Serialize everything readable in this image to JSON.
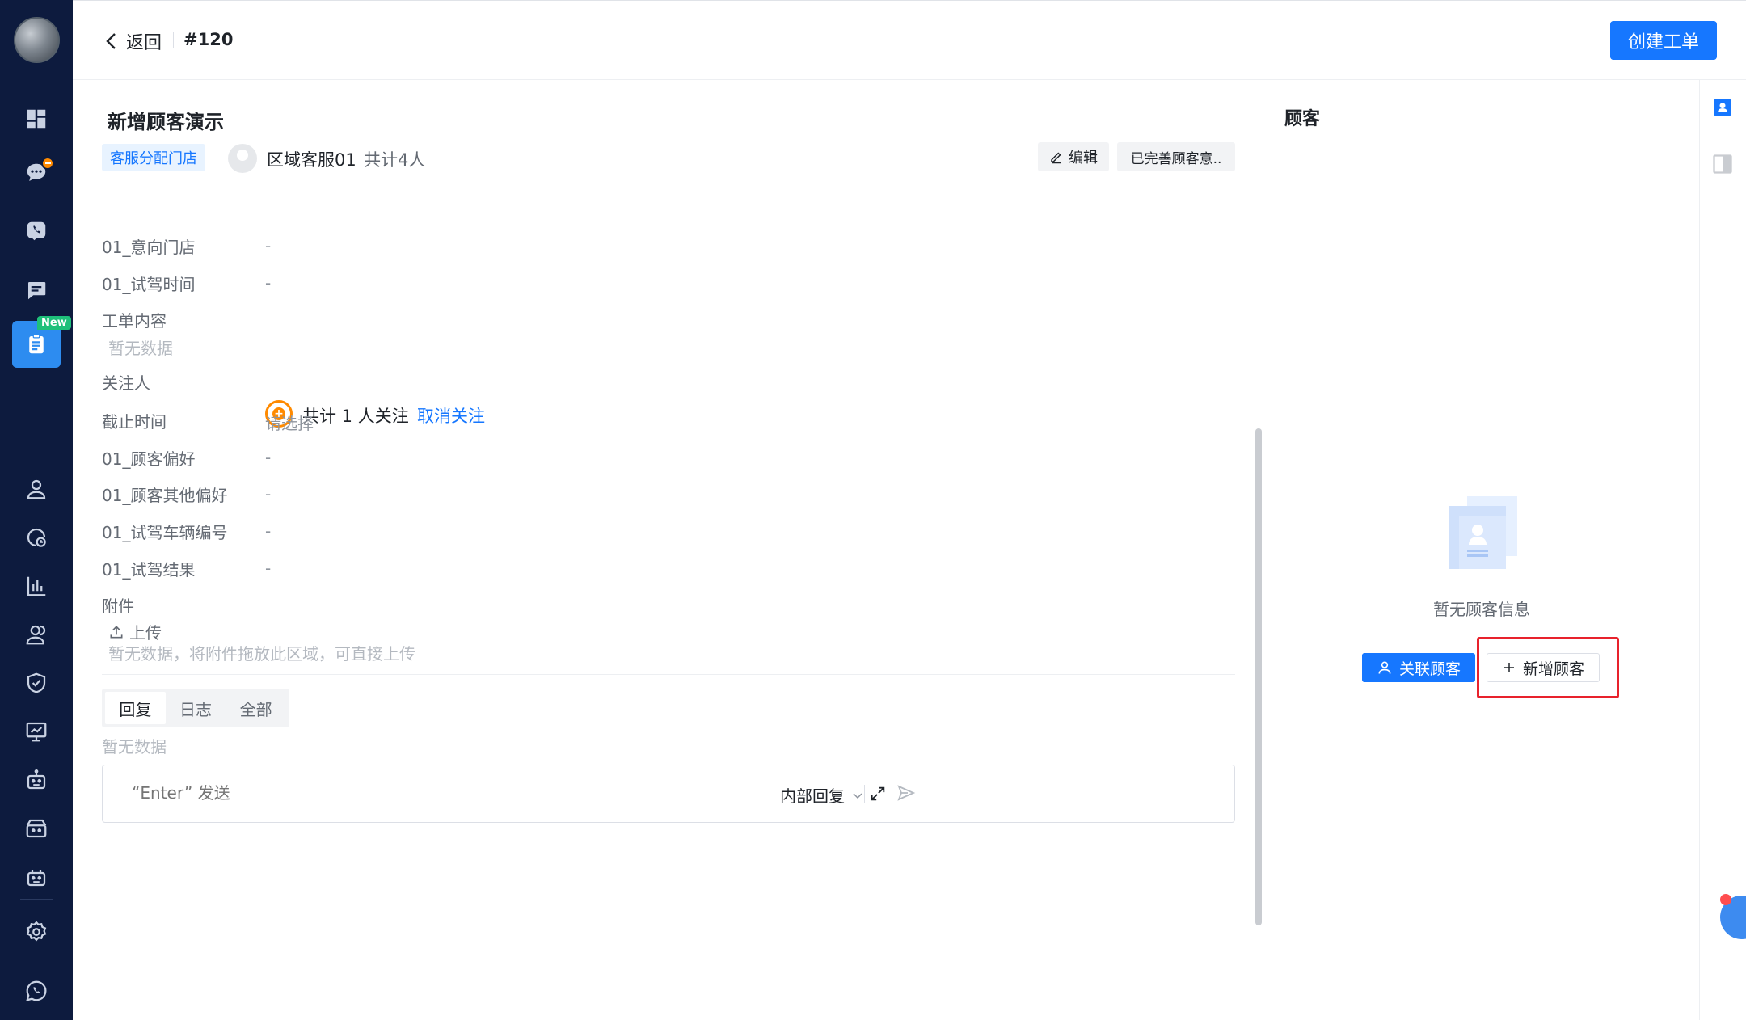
{
  "topbar": {
    "back_label": "返回",
    "ticket_no": "#120",
    "create_label": "创建工单"
  },
  "nav": {
    "items": [
      {
        "icon": "dashboard-icon"
      },
      {
        "icon": "chat-icon",
        "badge": "dot"
      },
      {
        "icon": "phone-icon"
      },
      {
        "icon": "message-icon"
      },
      {
        "icon": "ticket-icon",
        "badge": "New"
      },
      {
        "icon": "user-icon"
      },
      {
        "icon": "analytics-icon"
      },
      {
        "icon": "bar-chart-icon"
      },
      {
        "icon": "team-icon"
      },
      {
        "icon": "shield-icon"
      },
      {
        "icon": "monitor-icon"
      },
      {
        "icon": "robot-icon"
      },
      {
        "icon": "bot-store-icon"
      },
      {
        "icon": "bot-group-icon"
      },
      {
        "icon": "settings-icon"
      },
      {
        "icon": "whatsapp-icon"
      }
    ],
    "new_badge": "New",
    "colors": {
      "background": "#0d1b3e",
      "active": "#2d8cf0"
    }
  },
  "ticket": {
    "title": "新增顾客演示",
    "tag": "客服分配门店",
    "agent_name": "区域客服01",
    "agent_count": "共计4人",
    "edit_label": "编辑",
    "status_label": "已完善顾客意..",
    "fields": {
      "store": {
        "label": "01_意向门店",
        "value": "-"
      },
      "test_time": {
        "label": "01_试驾时间",
        "value": "-"
      },
      "content": {
        "label": "工单内容",
        "value": "暂无数据"
      },
      "followers": {
        "label": "关注人",
        "text": "共计 1 人关注",
        "action": "取消关注"
      },
      "deadline": {
        "label": "截止时间",
        "placeholder": "请选择"
      },
      "pref": {
        "label": "01_顾客偏好",
        "value": "-"
      },
      "other_pref": {
        "label": "01_顾客其他偏好",
        "value": "-"
      },
      "vehicle_no": {
        "label": "01_试驾车辆编号",
        "value": "-"
      },
      "result": {
        "label": "01_试驾结果",
        "value": "-"
      }
    },
    "attachment": {
      "label": "附件",
      "upload_label": "上传",
      "empty": "暂无数据，将附件拖放此区域，可直接上传"
    },
    "tabs": [
      "回复",
      "日志",
      "全部"
    ],
    "tab_empty": "暂无数据",
    "reply": {
      "placeholder": "“Enter” 发送",
      "mode": "内部回复"
    }
  },
  "customer": {
    "title": "顾客",
    "empty": "暂无顾客信息",
    "link_label": "关联顾客",
    "add_label": "新增顾客"
  },
  "colors": {
    "primary": "#1677ff",
    "highlight": "#e8222c",
    "follow": "#ff8a00"
  }
}
